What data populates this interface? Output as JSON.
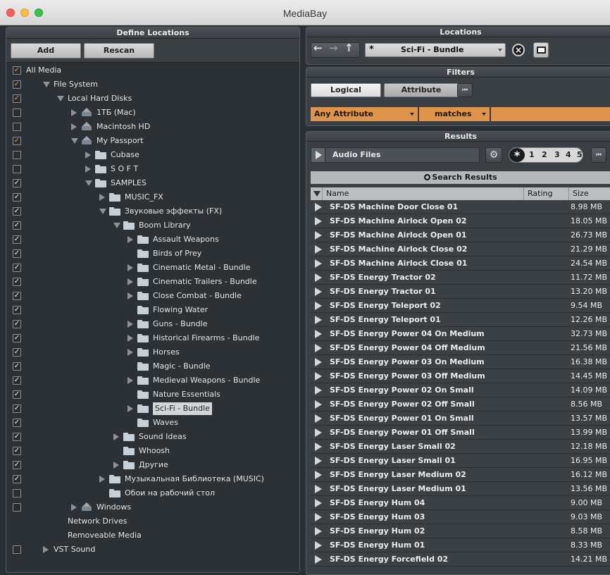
{
  "window": {
    "title": "MediaBay"
  },
  "define": {
    "header": "Define Locations",
    "add_label": "Add",
    "rescan_label": "Rescan",
    "tree": [
      {
        "label": "All Media",
        "check": "✓",
        "indent": 0,
        "tri": "",
        "icon": "",
        "checked_dim": true
      },
      {
        "label": "File System",
        "check": "✓",
        "indent": 1,
        "tri": "down",
        "icon": "",
        "checked_dim": true
      },
      {
        "label": "Local Hard Disks",
        "check": "✓",
        "indent": 2,
        "tri": "down",
        "icon": "",
        "checked_dim": true
      },
      {
        "label": "1TБ (Mac)",
        "check": "",
        "indent": 3,
        "tri": "right",
        "icon": "disk"
      },
      {
        "label": "Macintosh HD",
        "check": "",
        "indent": 3,
        "tri": "right",
        "icon": "disk"
      },
      {
        "label": "My Passport",
        "check": "✓",
        "indent": 3,
        "tri": "down",
        "icon": "disk",
        "checked_dim": true
      },
      {
        "label": "Cubase",
        "check": "",
        "indent": 4,
        "tri": "right",
        "icon": "folder"
      },
      {
        "label": "S O F T",
        "check": "",
        "indent": 4,
        "tri": "right",
        "icon": "folder"
      },
      {
        "label": "SAMPLES",
        "check": "✓",
        "indent": 4,
        "tri": "down",
        "icon": "folder"
      },
      {
        "label": "MUSIC_FX",
        "check": "✓",
        "indent": 5,
        "tri": "right",
        "icon": "folder"
      },
      {
        "label": "Звуковые эффекты (FX)",
        "check": "✓",
        "indent": 5,
        "tri": "down",
        "icon": "folder"
      },
      {
        "label": "Boom Library",
        "check": "✓",
        "indent": 6,
        "tri": "down",
        "icon": "folder"
      },
      {
        "label": "Assault Weapons",
        "check": "✓",
        "indent": 7,
        "tri": "right",
        "icon": "folder"
      },
      {
        "label": "Birds of Prey",
        "check": "✓",
        "indent": 7,
        "tri": "",
        "icon": "folder"
      },
      {
        "label": "Cinematic Metal - Bundle",
        "check": "✓",
        "indent": 7,
        "tri": "right",
        "icon": "folder"
      },
      {
        "label": "Cinematic Trailers - Bundle",
        "check": "✓",
        "indent": 7,
        "tri": "right",
        "icon": "folder"
      },
      {
        "label": "Close Combat - Bundle",
        "check": "✓",
        "indent": 7,
        "tri": "right",
        "icon": "folder"
      },
      {
        "label": "Flowing Water",
        "check": "✓",
        "indent": 7,
        "tri": "",
        "icon": "folder"
      },
      {
        "label": "Guns - Bundle",
        "check": "✓",
        "indent": 7,
        "tri": "right",
        "icon": "folder"
      },
      {
        "label": "Historical Firearms - Bundle",
        "check": "✓",
        "indent": 7,
        "tri": "right",
        "icon": "folder"
      },
      {
        "label": "Horses",
        "check": "✓",
        "indent": 7,
        "tri": "right",
        "icon": "folder"
      },
      {
        "label": "Magic - Bundle",
        "check": "✓",
        "indent": 7,
        "tri": "",
        "icon": "folder"
      },
      {
        "label": "Medieval Weapons - Bundle",
        "check": "✓",
        "indent": 7,
        "tri": "right",
        "icon": "folder"
      },
      {
        "label": "Nature Essentials",
        "check": "✓",
        "indent": 7,
        "tri": "",
        "icon": "folder"
      },
      {
        "label": "Sci-Fi - Bundle",
        "check": "✓",
        "indent": 7,
        "tri": "right",
        "icon": "folder",
        "selected": true
      },
      {
        "label": "Waves",
        "check": "✓",
        "indent": 7,
        "tri": "",
        "icon": "folder"
      },
      {
        "label": "Sound Ideas",
        "check": "✓",
        "indent": 6,
        "tri": "right",
        "icon": "folder"
      },
      {
        "label": "Whoosh",
        "check": "✓",
        "indent": 6,
        "tri": "",
        "icon": "folder"
      },
      {
        "label": "Другие",
        "check": "✓",
        "indent": 6,
        "tri": "right",
        "icon": "folder"
      },
      {
        "label": "Музыкальная Библиотека (MUSIC)",
        "check": "✓",
        "indent": 5,
        "tri": "right",
        "icon": "folder"
      },
      {
        "label": "Обои на рабочий стол",
        "check": "",
        "indent": 5,
        "tri": "",
        "icon": "folder"
      },
      {
        "label": "Windows",
        "check": "",
        "indent": 3,
        "tri": "right",
        "icon": "disk"
      },
      {
        "label": "Network Drives",
        "check": null,
        "indent": 2,
        "tri": "",
        "icon": ""
      },
      {
        "label": "Removeable Media",
        "check": null,
        "indent": 2,
        "tri": "",
        "icon": ""
      },
      {
        "label": "VST Sound",
        "check": "",
        "indent": 1,
        "tri": "right",
        "icon": ""
      }
    ]
  },
  "locations": {
    "header": "Locations",
    "current_prefix": "*",
    "current": "Sci-Fi - Bundle"
  },
  "filters": {
    "header": "Filters",
    "tab_logical": "Logical",
    "tab_attribute": "Attribute",
    "attribute": "Any Attribute",
    "condition": "matches",
    "value": ""
  },
  "results": {
    "header": "Results",
    "type_label": "Audio Files",
    "rating": [
      "*",
      "1",
      "2",
      "3",
      "4",
      "5"
    ],
    "search_label": "Search Results",
    "col_name": "Name",
    "col_rating": "Rating",
    "col_size": "Size",
    "rows": [
      {
        "name": "SF-DS Machine Door Close 01",
        "size": "8.98 MB"
      },
      {
        "name": "SF-DS Machine Airlock Open 02",
        "size": "18.05 MB"
      },
      {
        "name": "SF-DS Machine Airlock Open 01",
        "size": "26.73 MB"
      },
      {
        "name": "SF-DS Machine Airlock Close 02",
        "size": "21.29 MB"
      },
      {
        "name": "SF-DS Machine Airlock Close 01",
        "size": "24.54 MB"
      },
      {
        "name": "SF-DS Energy Tractor 02",
        "size": "11.72 MB"
      },
      {
        "name": "SF-DS Energy Tractor 01",
        "size": "13.20 MB"
      },
      {
        "name": "SF-DS Energy Teleport 02",
        "size": "9.54 MB"
      },
      {
        "name": "SF-DS Energy Teleport 01",
        "size": "12.26 MB"
      },
      {
        "name": "SF-DS Energy Power 04 On Medium",
        "size": "32.73 MB"
      },
      {
        "name": "SF-DS Energy Power 04 Off Medium",
        "size": "21.56 MB"
      },
      {
        "name": "SF-DS Energy Power 03 On Medium",
        "size": "16.38 MB"
      },
      {
        "name": "SF-DS Energy Power 03 Off Medium",
        "size": "14.45 MB"
      },
      {
        "name": "SF-DS Energy Power 02 On Small",
        "size": "14.09 MB"
      },
      {
        "name": "SF-DS Energy Power 02 Off Small",
        "size": "8.56 MB"
      },
      {
        "name": "SF-DS Energy Power 01 On Small",
        "size": "13.57 MB"
      },
      {
        "name": "SF-DS Energy Power 01 Off Small",
        "size": "13.99 MB"
      },
      {
        "name": "SF-DS Energy Laser Small 02",
        "size": "12.18 MB"
      },
      {
        "name": "SF-DS Energy Laser Small 01",
        "size": "16.95 MB"
      },
      {
        "name": "SF-DS Energy Laser Medium 02",
        "size": "16.12 MB"
      },
      {
        "name": "SF-DS Energy Laser Medium 01",
        "size": "13.56 MB"
      },
      {
        "name": "SF-DS Energy Hum 04",
        "size": "9.00 MB"
      },
      {
        "name": "SF-DS Energy Hum 03",
        "size": "9.03 MB"
      },
      {
        "name": "SF-DS Energy Hum 02",
        "size": "8.58 MB"
      },
      {
        "name": "SF-DS Energy Hum 01",
        "size": "8.33 MB"
      },
      {
        "name": "SF-DS Energy Forcefield 02",
        "size": "14.21 MB"
      }
    ]
  }
}
